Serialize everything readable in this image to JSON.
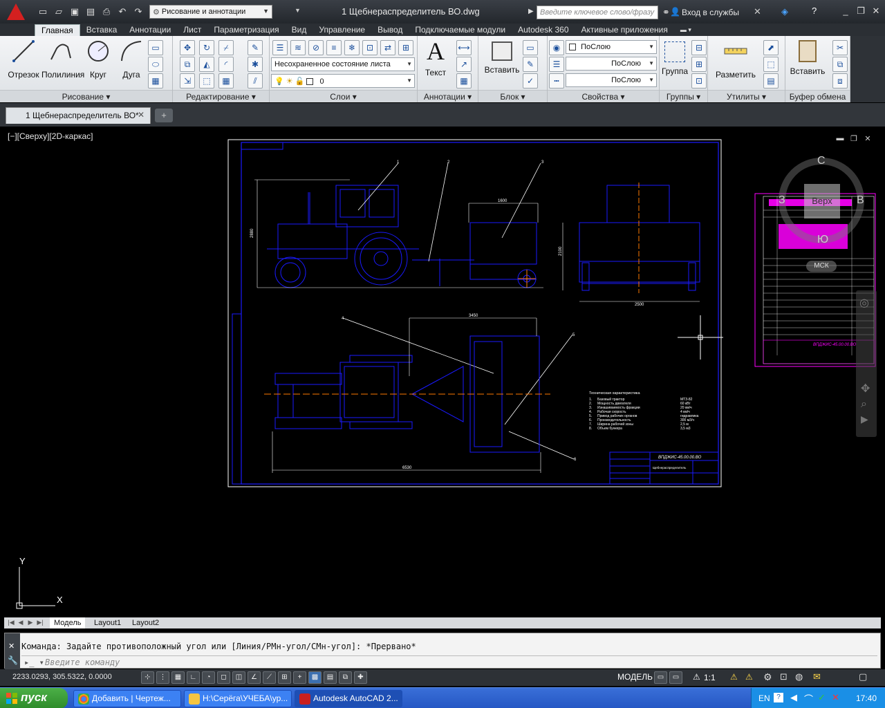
{
  "window": {
    "title": "1 Щебнераспределитель ВО.dwg",
    "workspace": "Рисование и аннотации",
    "search_placeholder": "Введите ключевое слово/фразу",
    "login": "Вход в службы"
  },
  "ribbon_tabs": [
    "Главная",
    "Вставка",
    "Аннотации",
    "Лист",
    "Параметризация",
    "Вид",
    "Управление",
    "Вывод",
    "Подключаемые модули",
    "Autodesk 360",
    "Активные приложения"
  ],
  "panels": {
    "draw": {
      "label": "Рисование",
      "tools": [
        "Отрезок",
        "Полилиния",
        "Круг",
        "Дуга"
      ]
    },
    "modify": {
      "label": "Редактирование"
    },
    "layers": {
      "label": "Слои",
      "state": "Несохраненное состояние листа",
      "current": "0"
    },
    "annotation": {
      "label": "Аннотации",
      "tool": "Текст"
    },
    "block": {
      "label": "Блок",
      "tool": "Вставить"
    },
    "properties": {
      "label": "Свойства",
      "color": "ПоСлою",
      "linetype": "ПоСлою",
      "lineweight": "ПоСлою"
    },
    "groups": {
      "label": "Группы",
      "tool": "Группа"
    },
    "utilities": {
      "label": "Утилиты",
      "tool": "Разметить"
    },
    "clipboard": {
      "label": "Буфер обмена",
      "tool": "Вставить"
    }
  },
  "file_tab": {
    "label": "1 Щебнераспределитель ВО*"
  },
  "viewport": {
    "label": "[−][Сверху][2D-каркас]",
    "viewcube": {
      "top": "Верх",
      "north": "С",
      "south": "Ю",
      "west": "З",
      "east": "В",
      "ucs": "МСК"
    }
  },
  "drawing_text": {
    "stamp": "ВПДЖИС-45.00.00.ВО",
    "title_block_name": "Щебнераспределитель",
    "dim_top_width": "1600",
    "dim_height": "2880",
    "dim_mid": "3450",
    "dim_side_height": "2100",
    "dim_side_width": "2500",
    "dim_plan_width": "6530",
    "tech_title": "Техническая характеристика",
    "tech_rows": [
      {
        "n": "1.",
        "name": "Базовый трактор",
        "value": "МТЗ-82"
      },
      {
        "n": "2.",
        "name": "Мощность двигателя",
        "value": "60 кВт"
      },
      {
        "n": "3.",
        "name": "Изнашиваемость фракции",
        "value": "20 км/ч"
      },
      {
        "n": "4.",
        "name": "Рабочая скорость",
        "value": "4 км/ч"
      },
      {
        "n": "5.",
        "name": "Привод рабочих органов",
        "value": "гидравлика"
      },
      {
        "n": "6.",
        "name": "Производительность",
        "value": "300 м3/ч"
      },
      {
        "n": "7.",
        "name": "Ширина рабочей зоны",
        "value": "2,5 м"
      },
      {
        "n": "8.",
        "name": "Объем бункера",
        "value": "3,5 м3"
      }
    ],
    "callouts": [
      "1",
      "2",
      "3",
      "4",
      "5",
      "6"
    ]
  },
  "layout_tabs": [
    "Модель",
    "Layout1",
    "Layout2"
  ],
  "command": {
    "history": "Команда: Задайте противоположный угол или [Линия/РМн-угол/СМн-угол]: *Прервано*",
    "placeholder": "Введите команду"
  },
  "status": {
    "coords": "2233.0293, 305.5322, 0.0000",
    "mode": "МОДЕЛЬ",
    "scale": "1:1"
  },
  "taskbar": {
    "start": "пуск",
    "items": [
      "Добавить | Чертеж...",
      "H:\\Серёга\\УЧЕБА\\ур...",
      "Autodesk AutoCAD 2..."
    ],
    "lang": "EN",
    "clock": "17:40"
  },
  "colors": {
    "drawing_line": "#1a1aff",
    "accent_magenta": "#ff00ff",
    "leader": "#ffffff",
    "center_line": "#ff7a00"
  }
}
